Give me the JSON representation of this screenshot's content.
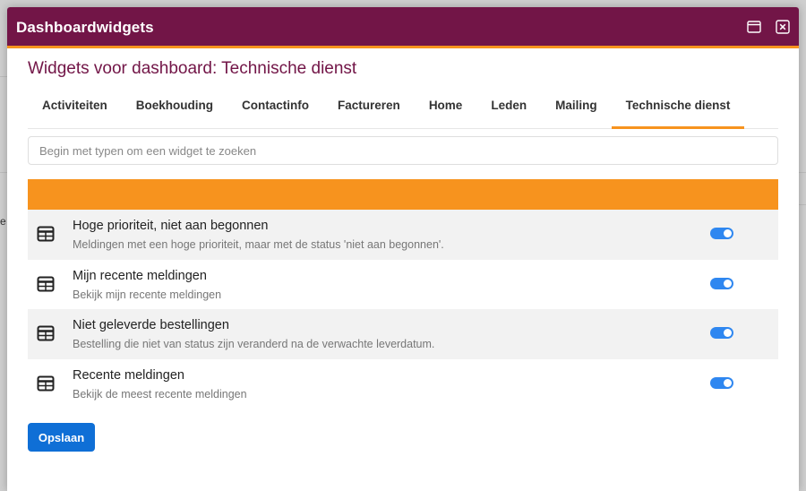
{
  "window": {
    "title": "Dashboardwidgets"
  },
  "heading": "Widgets voor dashboard: Technische dienst",
  "tabs": [
    {
      "label": "Activiteiten"
    },
    {
      "label": "Boekhouding"
    },
    {
      "label": "Contactinfo"
    },
    {
      "label": "Factureren"
    },
    {
      "label": "Home"
    },
    {
      "label": "Leden"
    },
    {
      "label": "Mailing"
    },
    {
      "label": "Technische dienst",
      "active": true
    }
  ],
  "search": {
    "placeholder": "Begin met typen om een widget te zoeken",
    "value": ""
  },
  "widgets": [
    {
      "title": "Hoge prioriteit, niet aan begonnen",
      "description": "Meldingen met een hoge prioriteit, maar met de status 'niet aan begonnen'.",
      "enabled": true
    },
    {
      "title": "Mijn recente meldingen",
      "description": "Bekijk mijn recente meldingen",
      "enabled": true
    },
    {
      "title": "Niet geleverde bestellingen",
      "description": "Bestelling die niet van status zijn veranderd na de verwachte leverdatum.",
      "enabled": true
    },
    {
      "title": "Recente meldingen",
      "description": "Bekijk de meest recente meldingen",
      "enabled": true
    }
  ],
  "save_label": "Opslaan",
  "background": {
    "fragment": "e"
  },
  "colors": {
    "titlebar": "#721547",
    "accent": "#f7931e",
    "toggle_on": "#2f87f0",
    "primary_button": "#0f6fd6"
  },
  "icons": {
    "maximize": "maximize-icon",
    "close": "close-icon",
    "widget": "table-icon"
  }
}
